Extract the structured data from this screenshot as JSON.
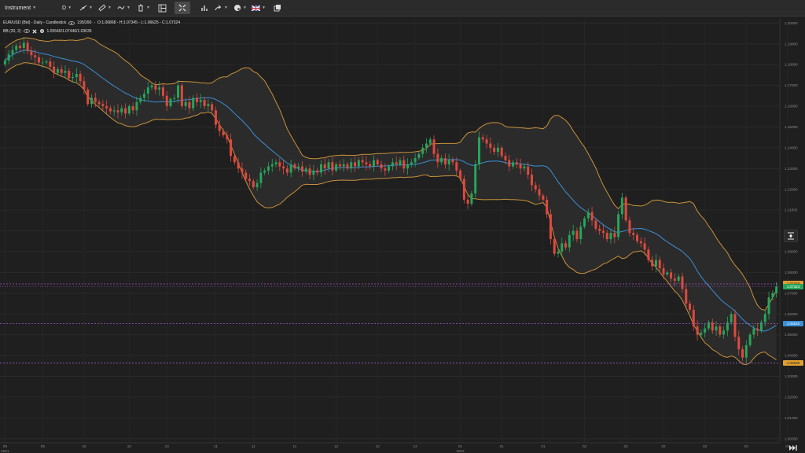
{
  "toolbar": {
    "instrument_label": "Instrument",
    "timeframe_label": "D"
  },
  "legend": {
    "title": "EUR/USD (Bid) - Daily - Candlestick",
    "bars": "195/390",
    "ohlc": "O:1.06868 - H:1.07345 - L:1.06625 - C:1.07324",
    "bb_name": "BB (20, 2)",
    "bb_values": "1.05540/1.07446/1.03635"
  },
  "colors": {
    "background": "#1f1f1f",
    "up": "#26a65b",
    "down": "#e0493f",
    "middle_band": "#3a8fd8",
    "outer_band": "#c8913a",
    "band_fill": "#2b2b2b",
    "guide": "#a259c9"
  },
  "price_labels": {
    "upper": "1.07446",
    "close": "1.07324",
    "middle": "1.05540",
    "lower": "1.03635"
  },
  "chart_data": {
    "type": "candlestick",
    "instrument": "EUR/USD",
    "y_ticks": [
      "1.20000",
      "1.19000",
      "1.18000",
      "1.17000",
      "1.16000",
      "1.15000",
      "1.14000",
      "1.13000",
      "1.12000",
      "1.11000",
      "1.10000",
      "1.09000",
      "1.08000",
      "1.07000",
      "1.06000",
      "1.05000",
      "1.04000",
      "1.03000",
      "1.02000",
      "1.01000",
      "1.00000"
    ],
    "ylim": [
      0.998,
      1.202
    ],
    "x_ticks": [
      {
        "label": "09",
        "sub": "2021",
        "i": 0
      },
      {
        "label": "09",
        "sub": "",
        "i": 10
      },
      {
        "label": "10",
        "sub": "",
        "i": 21
      },
      {
        "label": "10",
        "sub": "",
        "i": 33
      },
      {
        "label": "10",
        "sub": "",
        "i": 43
      },
      {
        "label": "11",
        "sub": "",
        "i": 56
      },
      {
        "label": "11",
        "sub": "",
        "i": 66
      },
      {
        "label": "11",
        "sub": "",
        "i": 77
      },
      {
        "label": "12",
        "sub": "",
        "i": 88
      },
      {
        "label": "12",
        "sub": "",
        "i": 99
      },
      {
        "label": "12",
        "sub": "",
        "i": 109
      },
      {
        "label": "01",
        "sub": "2022",
        "i": 121
      },
      {
        "label": "01",
        "sub": "",
        "i": 132
      },
      {
        "label": "01",
        "sub": "",
        "i": 143
      },
      {
        "label": "02",
        "sub": "",
        "i": 154
      },
      {
        "label": "02",
        "sub": "",
        "i": 165
      },
      {
        "label": "02",
        "sub": "",
        "i": 175
      },
      {
        "label": "03",
        "sub": "",
        "i": 186
      },
      {
        "label": "03",
        "sub": "",
        "i": 197
      },
      {
        "label": "03",
        "sub": "",
        "i": 208
      },
      {
        "label": "04",
        "sub": "",
        "i": 219
      },
      {
        "label": "04",
        "sub": "",
        "i": 230
      },
      {
        "label": "05",
        "sub": "",
        "i": 241
      },
      {
        "label": "05",
        "sub": "",
        "i": 252
      }
    ],
    "closes": [
      1.182,
      1.185,
      1.187,
      1.189,
      1.188,
      1.1905,
      1.1865,
      1.1845,
      1.1835,
      1.181,
      1.181,
      1.1815,
      1.179,
      1.176,
      1.1778,
      1.176,
      1.177,
      1.1735,
      1.174,
      1.1755,
      1.172,
      1.168,
      1.161,
      1.164,
      1.162,
      1.161,
      1.16,
      1.159,
      1.1575,
      1.158,
      1.157,
      1.159,
      1.1565,
      1.16,
      1.158,
      1.162,
      1.164,
      1.166,
      1.169,
      1.17,
      1.168,
      1.169,
      1.165,
      1.16,
      1.1635,
      1.164,
      1.17,
      1.16,
      1.162,
      1.159,
      1.164,
      1.162,
      1.163,
      1.16,
      1.161,
      1.158,
      1.151,
      1.148,
      1.146,
      1.144,
      1.136,
      1.133,
      1.13,
      1.128,
      1.125,
      1.124,
      1.121,
      1.123,
      1.128,
      1.129,
      1.131,
      1.132,
      1.133,
      1.131,
      1.13,
      1.128,
      1.132,
      1.13,
      1.131,
      1.1285,
      1.13,
      1.127,
      1.129,
      1.128,
      1.132,
      1.13,
      1.133,
      1.129,
      1.132,
      1.131,
      1.132,
      1.13,
      1.133,
      1.131,
      1.134,
      1.133,
      1.132,
      1.131,
      1.134,
      1.132,
      1.13,
      1.129,
      1.131,
      1.133,
      1.132,
      1.134,
      1.13,
      1.132,
      1.133,
      1.135,
      1.137,
      1.14,
      1.142,
      1.144,
      1.137,
      1.133,
      1.135,
      1.132,
      1.134,
      1.133,
      1.129,
      1.125,
      1.115,
      1.113,
      1.118,
      1.132,
      1.145,
      1.144,
      1.142,
      1.14,
      1.138,
      1.14,
      1.136,
      1.134,
      1.131,
      1.133,
      1.132,
      1.13,
      1.131,
      1.127,
      1.122,
      1.12,
      1.117,
      1.115,
      1.108,
      1.096,
      1.089,
      1.09,
      1.094,
      1.092,
      1.098,
      1.1,
      1.096,
      1.102,
      1.106,
      1.109,
      1.105,
      1.101,
      1.1,
      1.099,
      1.096,
      1.099,
      1.097,
      1.108,
      1.116,
      1.105,
      1.099,
      1.098,
      1.095,
      1.094,
      1.091,
      1.086,
      1.083,
      1.086,
      1.082,
      1.079,
      1.08,
      1.077,
      1.076,
      1.078,
      1.072,
      1.065,
      1.062,
      1.054,
      1.05,
      1.051,
      1.053,
      1.056,
      1.052,
      1.054,
      1.05,
      1.052,
      1.056,
      1.06,
      1.049,
      1.043,
      1.039,
      1.045,
      1.05,
      1.053,
      1.052,
      1.056,
      1.06,
      1.068,
      1.07,
      1.0732
    ]
  }
}
